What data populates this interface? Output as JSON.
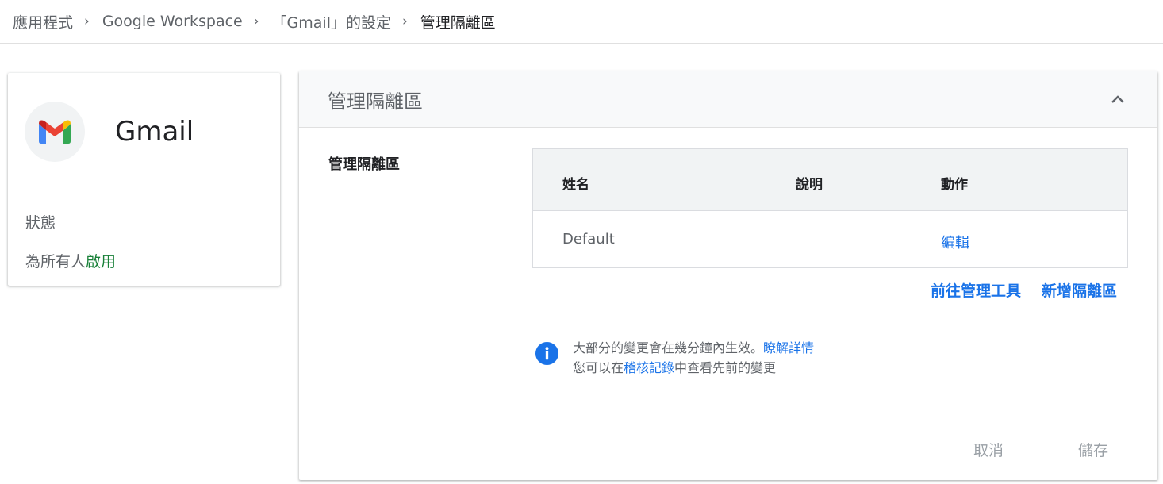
{
  "breadcrumb": {
    "items": [
      "應用程式",
      "Google Workspace",
      "「Gmail」的設定"
    ],
    "current": "管理隔離區"
  },
  "app_card": {
    "name": "Gmail",
    "status_label": "狀態",
    "status_prefix": "為所有人",
    "status_value": "啟用"
  },
  "panel": {
    "title": "管理隔離區",
    "section_label": "管理隔離區",
    "table": {
      "headers": [
        "姓名",
        "說明",
        "動作"
      ],
      "rows": [
        {
          "name": "Default",
          "description": "",
          "action": "編輯"
        }
      ]
    },
    "actions": {
      "go_to_admin": "前往管理工具",
      "add_quarantine": "新增隔離區"
    },
    "info": {
      "line1_text": "大部分的變更會在幾分鐘內生效。",
      "line1_link": "瞭解詳情",
      "line2_prefix": "您可以在",
      "line2_link": "稽核記錄",
      "line2_suffix": "中查看先前的變更"
    },
    "footer": {
      "cancel": "取消",
      "save": "儲存"
    }
  },
  "colors": {
    "link": "#1a73e8",
    "enabled": "#188038",
    "disabled_text": "#9aa0a6"
  }
}
